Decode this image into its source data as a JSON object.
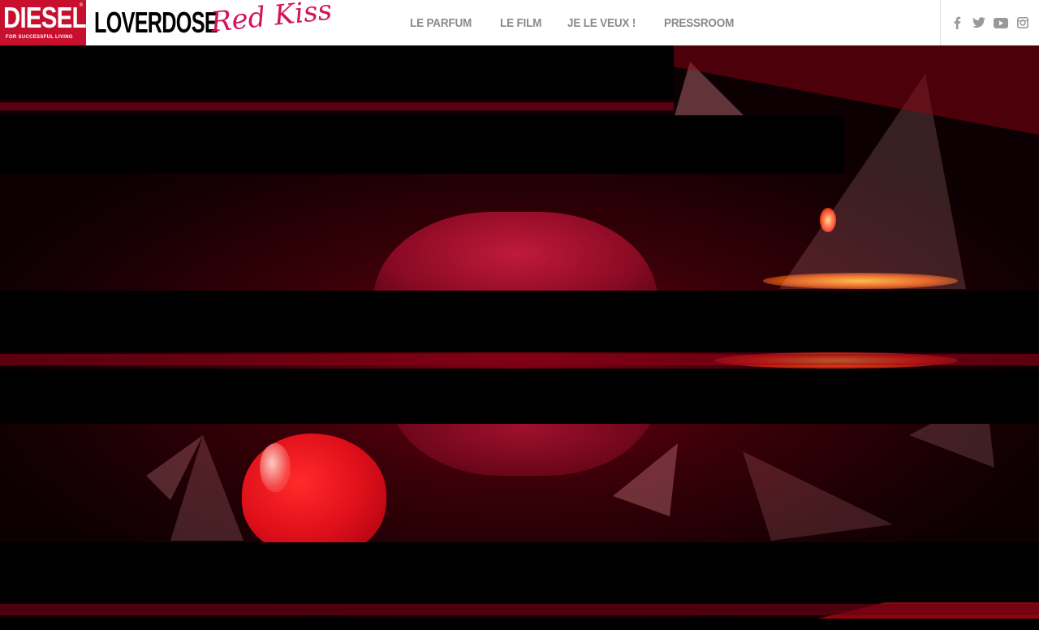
{
  "header": {
    "logo": {
      "word": "DIESEL",
      "tagline": "FOR SUCCESSFUL LIVING",
      "reg": "®"
    },
    "brand": {
      "main": "LOVERDOSE",
      "script": "Red Kiss"
    },
    "nav": [
      {
        "label": "LE PARFUM"
      },
      {
        "label": "LE FILM"
      },
      {
        "label": "JE LE VEUX !"
      },
      {
        "label": "PRESSROOM"
      }
    ],
    "social": [
      "facebook-icon",
      "twitter-icon",
      "youtube-icon",
      "instagram-icon"
    ]
  },
  "colors": {
    "brand_red": "#c8102e",
    "script_pink": "#d3145a",
    "nav_gray": "#8a8a8a"
  }
}
